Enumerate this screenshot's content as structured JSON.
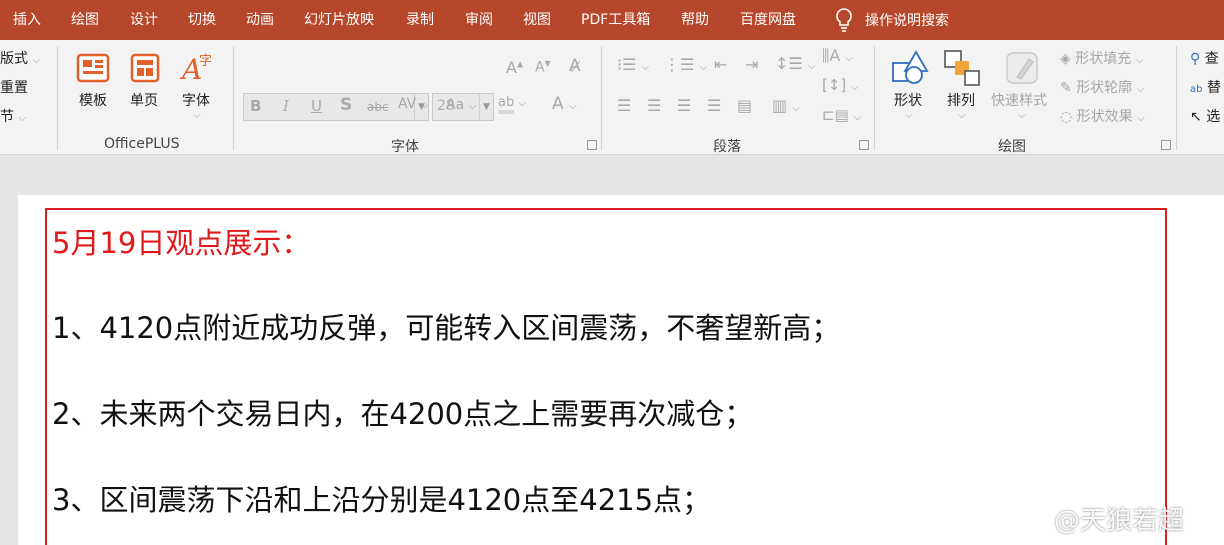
{
  "menu": {
    "items": [
      "插入",
      "绘图",
      "设计",
      "切换",
      "动画",
      "幻灯片放映",
      "录制",
      "审阅",
      "视图",
      "PDF工具箱",
      "帮助",
      "百度网盘"
    ],
    "search_label": "操作说明搜索"
  },
  "ribbon": {
    "left_partial": [
      "版式",
      "重置",
      "节"
    ],
    "officeplus": {
      "buttons": [
        "模板",
        "单页",
        "字体"
      ],
      "group_label": "OfficePLUS"
    },
    "font": {
      "size_value": "28",
      "group_label": "字体"
    },
    "paragraph": {
      "group_label": "段落"
    },
    "drawing": {
      "shape_label": "形状",
      "arrange_label": "排列",
      "quickstyle_label": "快速样式",
      "fill_label": "形状填充",
      "outline_label": "形状轮廓",
      "effect_label": "形状效果",
      "group_label": "绘图"
    },
    "right_partial": [
      "查",
      "替",
      "选"
    ]
  },
  "document": {
    "title": "5月19日观点展示：",
    "points": [
      "1、4120点附近成功反弹，可能转入区间震荡，不奢望新高；",
      "2、未来两个交易日内，在4200点之上需要再次减仓；",
      "3、区间震荡下沿和上沿分别是4120点至4215点；"
    ]
  },
  "watermark": "@天狼若超",
  "colors": {
    "menubar": "#b7472a",
    "title_text": "#e0191b",
    "textbox_border": "#d81e1e"
  }
}
